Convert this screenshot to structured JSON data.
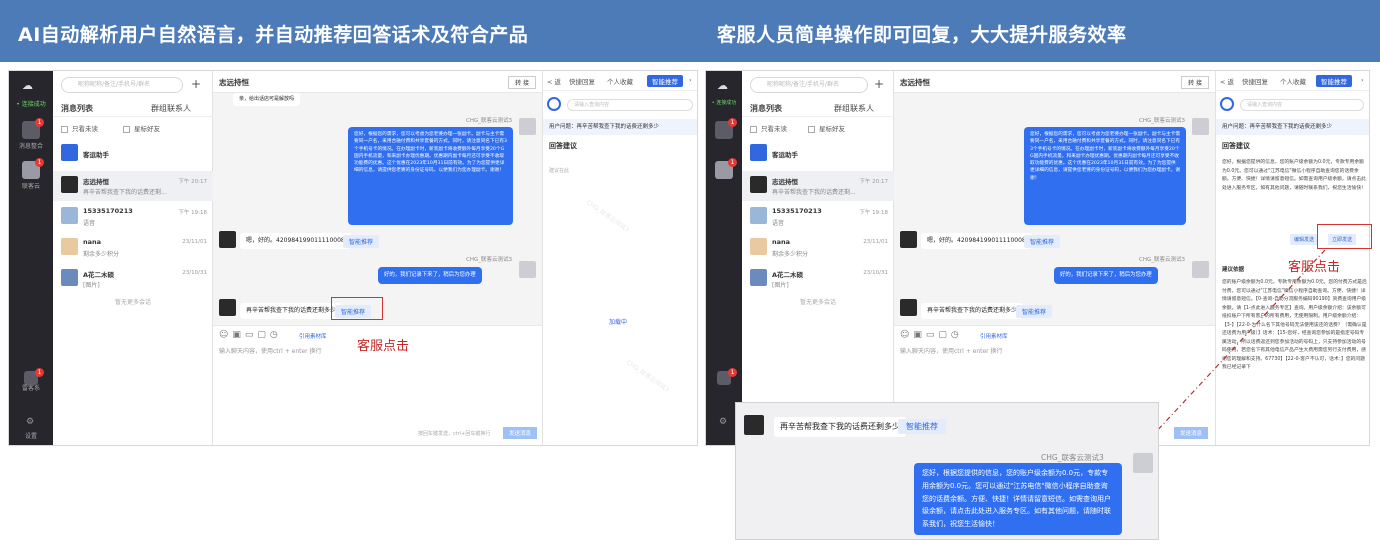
{
  "banner": {
    "left_title": "AI自动解析用户自然语言，并自动推荐回答话术及符合产品",
    "right_title": "客服人员简单操作即可回复，大大提升服务效率"
  },
  "colors": {
    "banner": "#4d7bb8",
    "accent": "#2f6ff0",
    "annotation": "#d43333"
  },
  "sidebar": {
    "status": "• 连接成功",
    "items": [
      {
        "label": "消息整合",
        "badge": "1"
      },
      {
        "label": "联客云",
        "badge": "1"
      },
      {
        "label": "雷客系",
        "badge": "1"
      },
      {
        "label": "设置",
        "badge": ""
      }
    ]
  },
  "list": {
    "search_placeholder": "昵称昵称/备注/手机号/群名",
    "tab_messages": "消息列表",
    "tab_groups": "群组联系人",
    "filter_unread": "只看未读",
    "filter_star": "星标好友",
    "assistant": "客运助手",
    "rows": [
      {
        "name": "志远持恒",
        "preview": "再辛苦帮我查下我的话费还剩...",
        "time": "下午 20:17"
      },
      {
        "name": "15335170213",
        "preview": "语音",
        "time": "下午 19:18"
      },
      {
        "name": "nana",
        "preview": "剩余多少积分",
        "time": "23/11/01"
      },
      {
        "name": "A花二木硕",
        "preview": "[图片]",
        "time": "23/10/31"
      }
    ],
    "no_more": "暂无更多会话"
  },
  "chat": {
    "title": "志远持恒",
    "transfer": "转 接",
    "top_msg": "亲，给出话店可是解放吗",
    "agent_name": "CHG_联客云测试3",
    "reply1": "您好，根据您的需求，您可以考虑为您老婆办理一张副卡。副卡与主卡需要同一户名，采用合融付费和共享套餐的方式。同时，请注意同名下已有3个手机号卡的情况。在办理副卡时，新装副卡将收费额外每月享受20个G国内手机流量，和来副卡办理优惠期。优惠期内副卡每月还可享受不收取功能费的优惠。这个优惠在2023年10月31日前有效。为了为您提供更详细的信息，请提供您老婆的身份证号码，以便我们为您办理副卡。谢谢！",
    "user_msg1": "嗯，好的。420984199011110008",
    "smart_label": "智能推荐",
    "reply2": "好的，我们记录下来了，稍后为您办理",
    "user_msg2": "再辛苦帮我查下我的话费还剩多少",
    "toolbar_more": "引用素材库",
    "input_placeholder": "输入聊天内容，使用ctrl + enter 换行",
    "footer_hint": "按回车键发送，ctrl+回车键换行",
    "send": "发送消息"
  },
  "right": {
    "back": "< 返",
    "tabs": [
      "快捷回复",
      "个人收藏",
      "智能推荐"
    ],
    "query_placeholder": "请输入查询内容",
    "user_question": "用户问题：再辛苦帮我查下我的话费还剩多少",
    "suggest_title": "回答建议",
    "empty": "建议在此",
    "loading": "加载中",
    "answer": "您好，根据您提供的信息，您的账户级余额为0.0元，专款专用余额为0.0元。您可以通过\"江苏电信\"微信小程序自助查询您的话费余额。方便、快捷！详情请留意短信。如需查询用户级余额，请点击此处进入服务专区。如有其他问题，请随时联系我们，祝您生活愉快！",
    "edit_send": "编辑发送",
    "send_now": "立即发送",
    "recommend_title": "建议依据",
    "kb_text": "您的账户级余额为0.0元，专款专用余额为0.0元。您的付费方式是后付费，您可以通过\"江苏电信\"微信小程序自助查询。方便、快捷！详情请留意短信。【0-查询-自助分流服务编码90190】资费查询用户级余额，请【1-点此进入服务专区】查询。用户级余额介绍：该余额可抵扣账户下所有客户的所有费用，无使用限制。用户级余额介绍：【3-】【22-0-为什么名下其他号码无法使用该还的话费？（需确认是还话费为用户级）】话术：【15-您好，经查询您参加的是指定号码专属活动，所以话费返还到您参加活动的号码上，只支持参加活动的号码使用，若您名下有其他电信产品产生大费用需您另行支付费用，感谢您的理解和支持。67730】【22-0-客户不认可，话术：】您的问题我已经记录下"
  },
  "annotations": {
    "click1": "客服点击",
    "click2": "客服点击"
  },
  "zoom": {
    "user_msg": "再辛苦帮我查下我的话费还剩多少",
    "smart_label": "智能推荐",
    "agent_name": "CHG_联客云测试3",
    "reply": "您好，根据您提供的信息，您的账户级余额为0.0元，专款专用余额为0.0元。您可以通过\"江苏电信\"微信小程序自助查询您的话费余额。方便、快捷！详情请留意短信。如需查询用户级余额，请点击此处进入服务专区。如有其他问题，请随时联系我们，祝您生活愉快！"
  }
}
